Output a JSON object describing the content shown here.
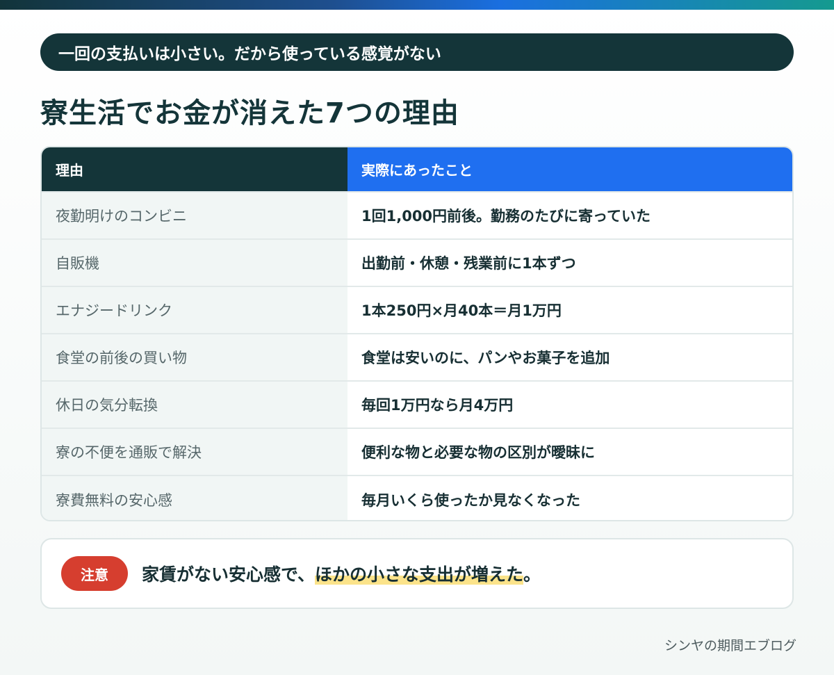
{
  "tagline": "一回の支払いは小さい。だから使っている感覚がない",
  "title": "寮生活でお金が消えた7つの理由",
  "table": {
    "headers": [
      "理由",
      "実際にあったこと"
    ],
    "rows": [
      [
        "夜勤明けのコンビニ",
        "1回1,000円前後。勤務のたびに寄っていた"
      ],
      [
        "自販機",
        "出勤前・休憩・残業前に1本ずつ"
      ],
      [
        "エナジードリンク",
        "1本250円×月40本＝月1万円"
      ],
      [
        "食堂の前後の買い物",
        "食堂は安いのに、パンやお菓子を追加"
      ],
      [
        "休日の気分転換",
        "毎回1万円なら月4万円"
      ],
      [
        "寮の不便を通販で解決",
        "便利な物と必要な物の区別が曖昧に"
      ],
      [
        "寮費無料の安心感",
        "毎月いくら使ったか見なくなった"
      ]
    ]
  },
  "note": {
    "badge": "注意",
    "text_before": "家賃がない安心感で、",
    "text_highlight": "ほかの小さな支出が増えた",
    "text_after": "。"
  },
  "footer": "シンヤの期間エブログ",
  "colors": {
    "dark": "#143539",
    "blue": "#1f6ff0",
    "red": "#d63e2f",
    "highlight": "#fbe38a"
  }
}
